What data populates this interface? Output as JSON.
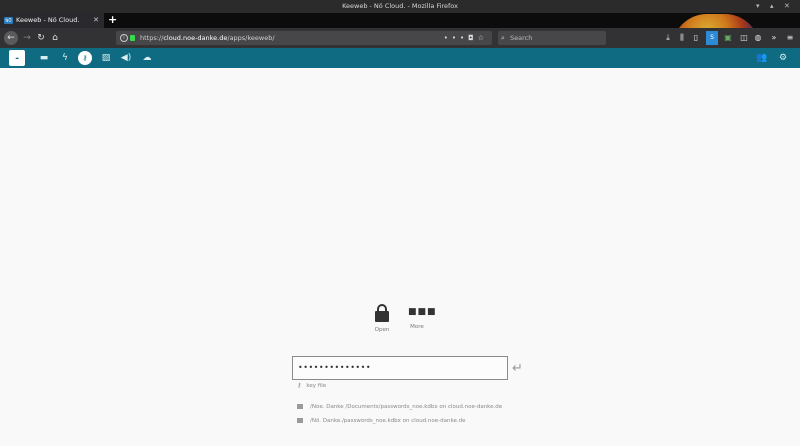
{
  "window": {
    "title": "Keeweb - Nö Cloud. - Mozilla Firefox"
  },
  "tab": {
    "label": "Keeweb - Nö Cloud."
  },
  "urlbar": {
    "scheme": "https://",
    "host": "cloud.noe-danke.de",
    "path": "/apps/keeweb/"
  },
  "search": {
    "placeholder": "Search"
  },
  "keeweb": {
    "open_label": "Open",
    "more_label": "More",
    "password_value": "••••••••••••••",
    "keyfile_label": "key file",
    "recent_files": [
      "/Noe. Danke /Documents/passwords_noe.kdbx on cloud.noe-danke.de",
      "/Nö. Danke./passwords_noe.kdbx on cloud.noe-danke.de"
    ]
  },
  "colors": {
    "appbar": "#0e6b82",
    "chrome": "#323234",
    "lock_green": "#38d94b"
  }
}
